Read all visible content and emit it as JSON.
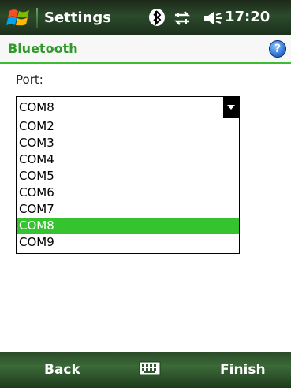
{
  "titlebar": {
    "app_name": "Settings",
    "icons": [
      "windows-start-icon",
      "bluetooth-icon",
      "connectivity-icon",
      "volume-icon"
    ],
    "time": "17:20"
  },
  "header": {
    "title": "Bluetooth",
    "help_icon": "help-icon",
    "accent": "#3dbb32"
  },
  "form": {
    "port_label": "Port:",
    "selected_port": "COM8",
    "options": [
      "COM2",
      "COM3",
      "COM4",
      "COM5",
      "COM6",
      "COM7",
      "COM8",
      "COM9"
    ],
    "selected_index": 6
  },
  "softkeys": {
    "left": "Back",
    "center_icon": "keyboard-icon",
    "right": "Finish"
  }
}
